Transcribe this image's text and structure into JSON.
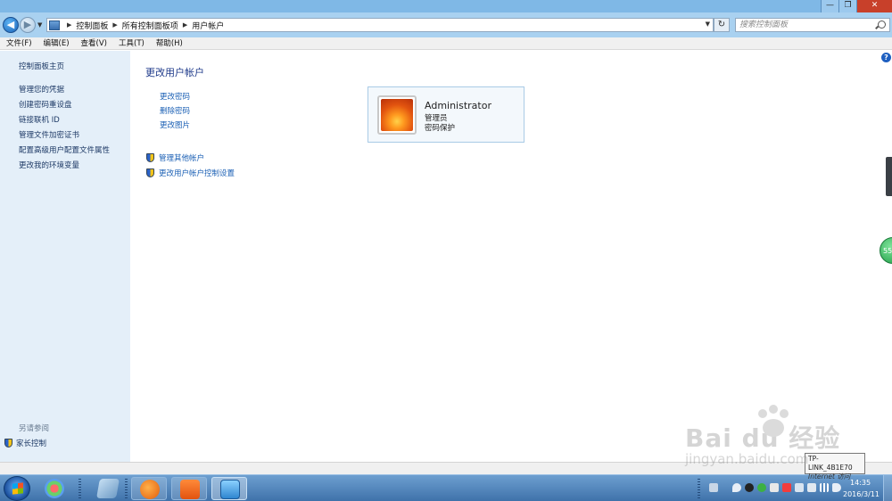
{
  "window": {
    "min_label": "—",
    "max_label": "❐",
    "close_label": "✕"
  },
  "address": {
    "crumbs": [
      "控制面板",
      "所有控制面板项",
      "用户帐户"
    ],
    "search_placeholder": "搜索控制面板"
  },
  "menu": [
    "文件(F)",
    "编辑(E)",
    "查看(V)",
    "工具(T)",
    "帮助(H)"
  ],
  "sidebar": {
    "home": "控制面板主页",
    "links": [
      "管理您的凭据",
      "创建密码重设盘",
      "链接联机 ID",
      "管理文件加密证书",
      "配置高级用户配置文件属性",
      "更改我的环境变量"
    ],
    "see_also": "另请参阅",
    "family": "家长控制"
  },
  "main": {
    "title": "更改用户帐户",
    "tasks": [
      "更改密码",
      "删除密码",
      "更改图片"
    ],
    "admin_tasks": [
      "管理其他帐户",
      "更改用户帐户控制设置"
    ],
    "user": {
      "name": "Administrator",
      "role": "管理员",
      "status": "密码保护"
    }
  },
  "help_label": "?",
  "side_ball_label": "55",
  "taskbar": {
    "time": "14:35",
    "date": "2016/3/11"
  },
  "tooltip": {
    "line1": "TP-LINK_4B1E70",
    "line2": "Internet 访问"
  },
  "watermark": {
    "brand": "Bai du 经验",
    "url": "jingyan.baidu.com"
  }
}
